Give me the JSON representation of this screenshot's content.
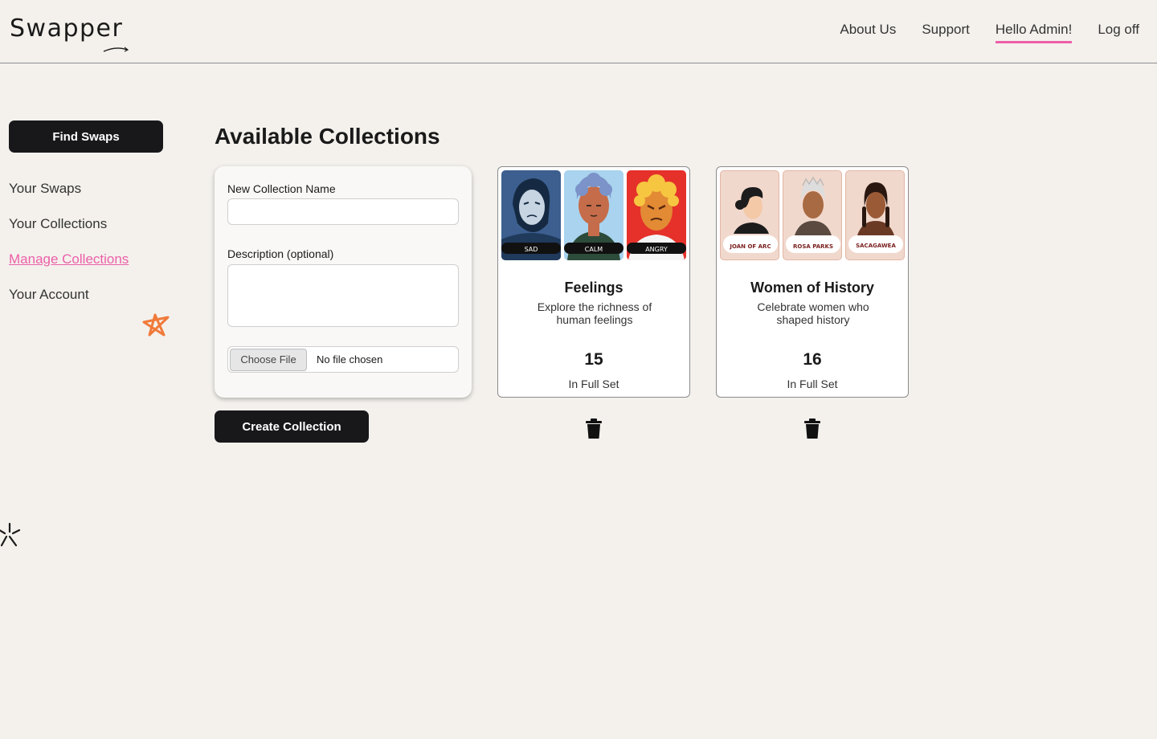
{
  "header": {
    "logo": "Swapper",
    "nav": {
      "about": "About Us",
      "support": "Support",
      "greeting": "Hello Admin!",
      "logout": "Log off"
    }
  },
  "sidebar": {
    "find_swaps": "Find Swaps",
    "items": [
      "Your Swaps",
      "Your Collections",
      "Manage Collections",
      "Your Account"
    ],
    "active_item": "Manage Collections"
  },
  "main": {
    "title": "Available Collections",
    "form": {
      "name_label": "New Collection Name",
      "name_value": "",
      "description_label": "Description (optional)",
      "description_value": "",
      "choose_file_label": "Choose File",
      "file_status": "No file chosen",
      "create_button": "Create Collection"
    },
    "collections": [
      {
        "title": "Feelings",
        "description": "Explore the richness of human feelings",
        "count": "15",
        "count_label": "In Full Set",
        "cards": [
          "SAD",
          "CALM",
          "ANGRY"
        ]
      },
      {
        "title": "Women of History",
        "description": "Celebrate women who shaped history",
        "count": "16",
        "count_label": "In Full Set",
        "cards": [
          "JOAN OF ARC",
          "ROSA PARKS",
          "SACAGAWEA"
        ]
      }
    ]
  },
  "colors": {
    "accent_pink": "#ec5fa8",
    "accent_orange": "#f07a3a",
    "button_dark": "#18181b",
    "background": "#f4f1ed"
  },
  "icons": [
    "star-doodle-icon",
    "sparkle-doodle-icon",
    "trash-icon"
  ]
}
